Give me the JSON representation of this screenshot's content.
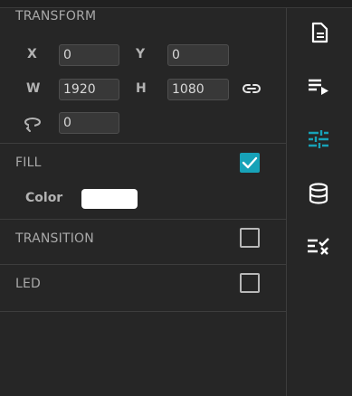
{
  "transform": {
    "title": "TRANSFORM",
    "x_label": "X",
    "x_value": "0",
    "y_label": "Y",
    "y_value": "0",
    "w_label": "W",
    "w_value": "1920",
    "h_label": "H",
    "h_value": "1080",
    "rotation_value": "0",
    "link_icon": "link-icon",
    "rotation_icon": "rotate-icon"
  },
  "fill": {
    "title": "FILL",
    "checked": true,
    "color_label": "Color",
    "color_value": "#ffffff"
  },
  "transition": {
    "title": "TRANSITION",
    "checked": false
  },
  "led": {
    "title": "LED",
    "checked": false
  },
  "sidebar": {
    "items": [
      {
        "icon": "document-icon",
        "active": false
      },
      {
        "icon": "playlist-icon",
        "active": false
      },
      {
        "icon": "sliders-icon",
        "active": true
      },
      {
        "icon": "database-icon",
        "active": false
      },
      {
        "icon": "checklist-icon",
        "active": false
      }
    ]
  },
  "colors": {
    "accent": "#17a2b8",
    "background": "#262626",
    "text": "#b3b3b3"
  }
}
